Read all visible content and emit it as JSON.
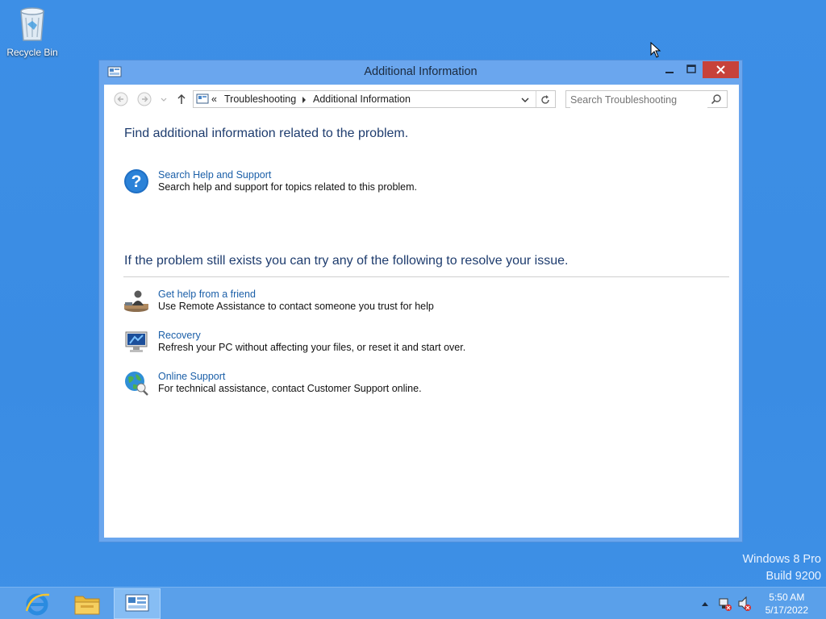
{
  "desktop": {
    "recycle_bin_label": "Recycle Bin",
    "watermark": {
      "line1": "Windows 8 Pro",
      "line2": "Build 9200"
    }
  },
  "window": {
    "title": "Additional Information",
    "address": {
      "overflow": "«",
      "crumbs": [
        "Troubleshooting",
        "Additional Information"
      ]
    },
    "search_placeholder": "Search Troubleshooting",
    "content": {
      "heading1": "Find additional information related to the problem.",
      "help_item": {
        "link": "Search Help and Support",
        "desc": "Search help and support for topics related to this problem."
      },
      "heading2": "If the problem still exists you can try any of the following to resolve your issue.",
      "items": [
        {
          "link": "Get help from a friend",
          "desc": "Use Remote Assistance to contact someone you trust for help"
        },
        {
          "link": "Recovery",
          "desc": "Refresh your PC without affecting your files, or reset it and start over."
        },
        {
          "link": "Online Support",
          "desc": "For technical assistance, contact Customer Support online."
        }
      ]
    }
  },
  "taskbar": {
    "clock": {
      "time": "5:50 AM",
      "date": "5/17/2022"
    }
  },
  "colors": {
    "desktop": "#3a8ce3",
    "window_frame": "#6aa6ee",
    "close_button": "#c7423a",
    "link": "#1b5fa8",
    "heading": "#1e3c6e"
  }
}
